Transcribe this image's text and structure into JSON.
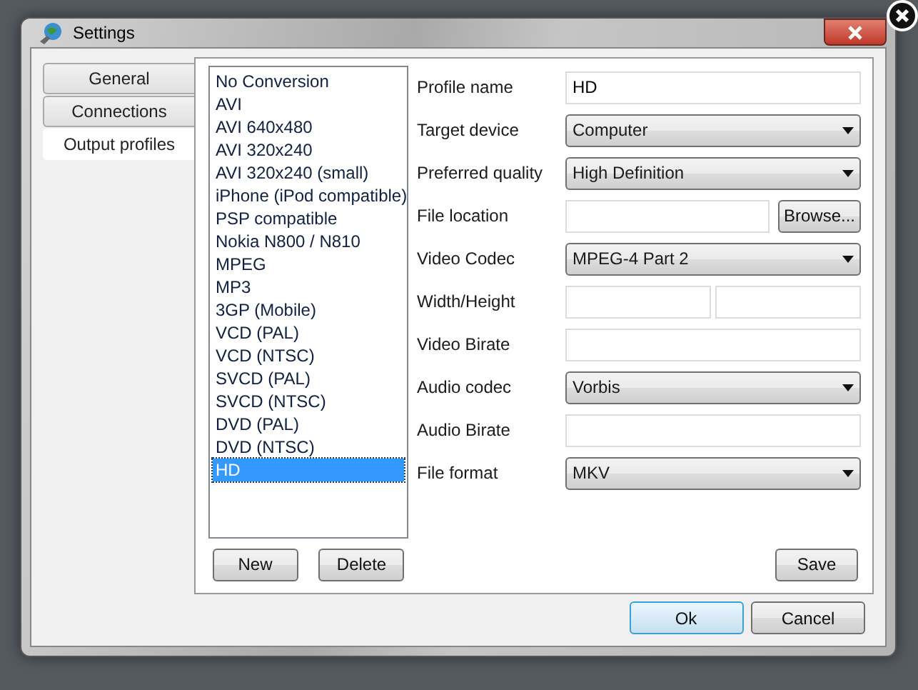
{
  "window": {
    "title": "Settings"
  },
  "tabs": [
    {
      "label": "General",
      "selected": false
    },
    {
      "label": "Connections",
      "selected": false
    },
    {
      "label": "Output profiles",
      "selected": true
    }
  ],
  "profiles": [
    {
      "label": "No Conversion",
      "selected": false
    },
    {
      "label": "AVI",
      "selected": false
    },
    {
      "label": "AVI 640x480",
      "selected": false
    },
    {
      "label": "AVI 320x240",
      "selected": false
    },
    {
      "label": "AVI 320x240 (small)",
      "selected": false
    },
    {
      "label": "iPhone (iPod compatible)",
      "selected": false
    },
    {
      "label": "PSP compatible",
      "selected": false
    },
    {
      "label": "Nokia N800 / N810",
      "selected": false
    },
    {
      "label": "MPEG",
      "selected": false
    },
    {
      "label": "MP3",
      "selected": false
    },
    {
      "label": "3GP (Mobile)",
      "selected": false
    },
    {
      "label": "VCD (PAL)",
      "selected": false
    },
    {
      "label": "VCD (NTSC)",
      "selected": false
    },
    {
      "label": "SVCD (PAL)",
      "selected": false
    },
    {
      "label": "SVCD (NTSC)",
      "selected": false
    },
    {
      "label": "DVD (PAL)",
      "selected": false
    },
    {
      "label": "DVD (NTSC)",
      "selected": false
    },
    {
      "label": "HD",
      "selected": true
    }
  ],
  "list_buttons": [
    "New",
    "Delete"
  ],
  "fields": [
    {
      "kind": "text",
      "label": "Profile name",
      "value": "HD"
    },
    {
      "kind": "select",
      "label": "Target device",
      "value": "Computer"
    },
    {
      "kind": "select",
      "label": "Preferred quality",
      "value": "High Definition"
    },
    {
      "kind": "file",
      "label": "File location",
      "button": "Browse..."
    },
    {
      "kind": "select",
      "label": "Video Codec",
      "value": "MPEG-4 Part 2"
    },
    {
      "kind": "pair",
      "label": "Width/Height"
    },
    {
      "kind": "text",
      "label": "Video Birate"
    },
    {
      "kind": "select",
      "label": "Audio codec",
      "value": "Vorbis"
    },
    {
      "kind": "text",
      "label": "Audio Birate"
    },
    {
      "kind": "select",
      "label": "File format",
      "value": "MKV"
    }
  ],
  "save_button": "Save",
  "dialog_buttons": [
    {
      "label": "Ok",
      "focused": true
    },
    {
      "label": "Cancel",
      "focused": false
    }
  ]
}
